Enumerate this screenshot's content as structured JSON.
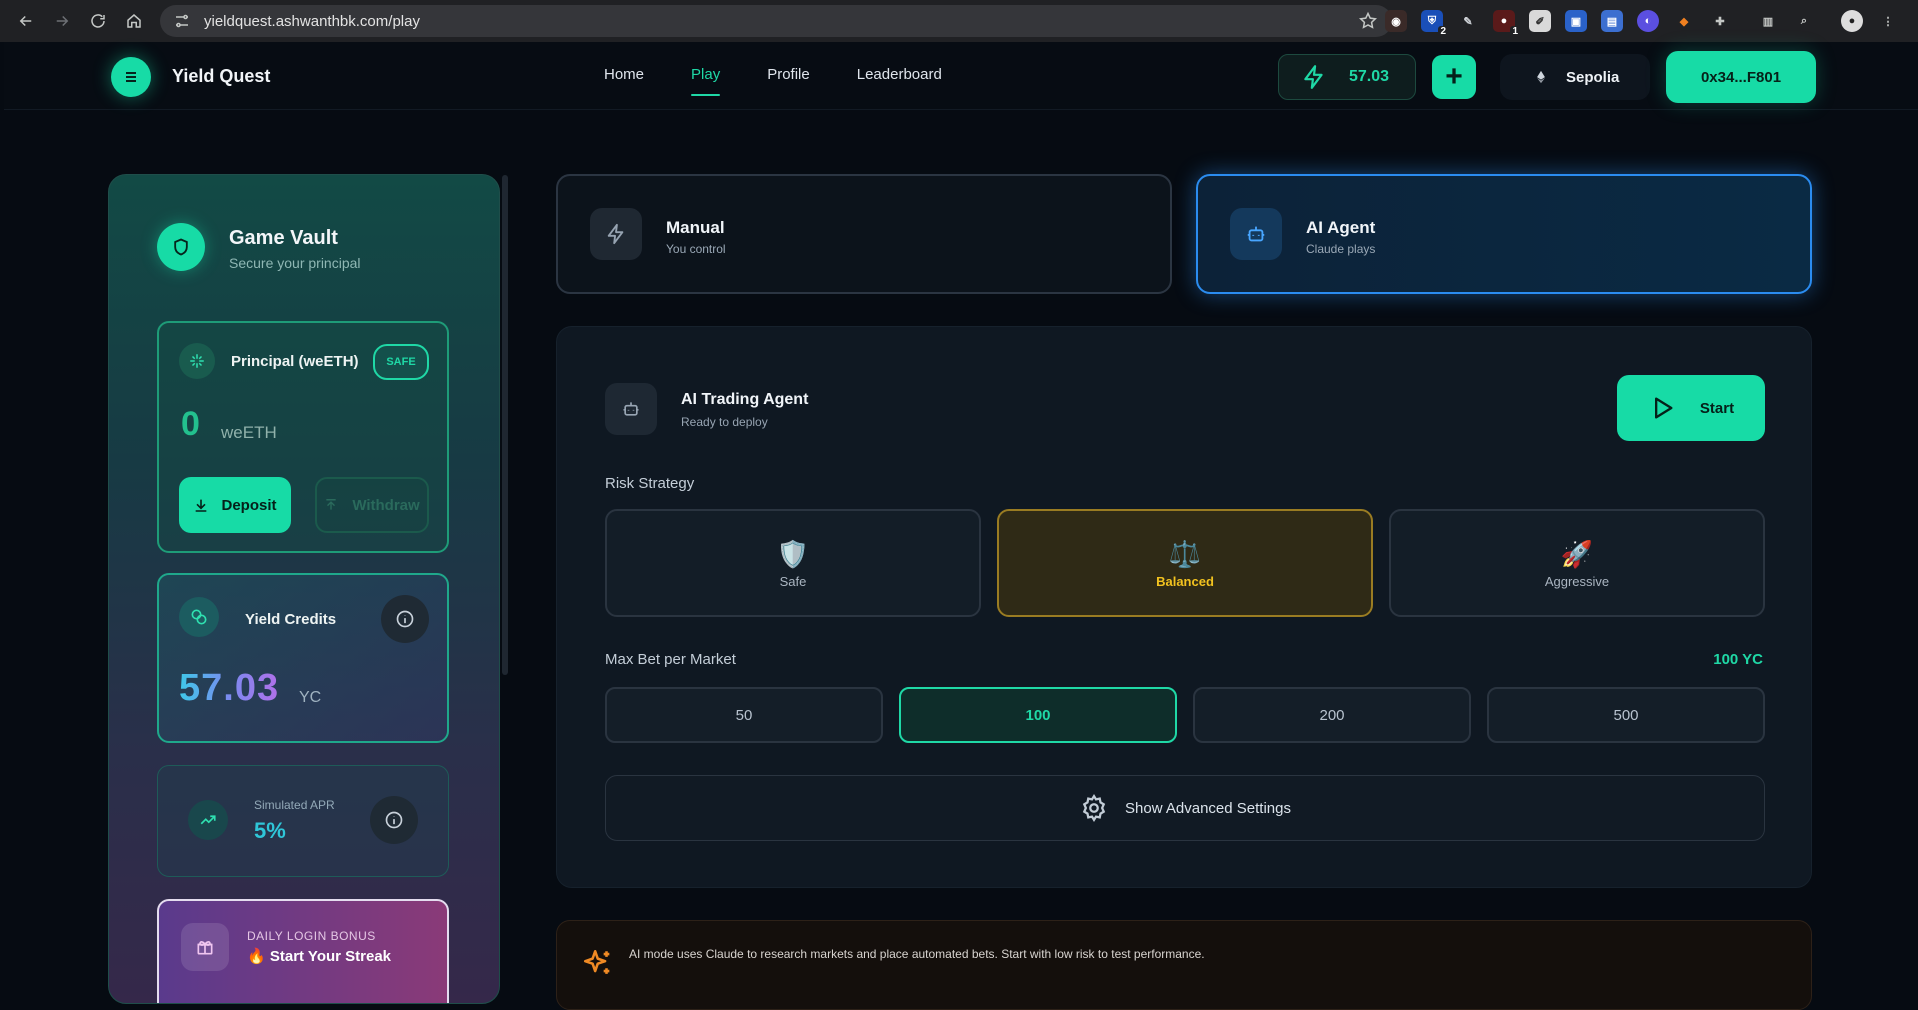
{
  "browser": {
    "url": "yieldquest.ashwanthbk.com/play",
    "extension_badges": [
      "2",
      "1"
    ]
  },
  "header": {
    "brand": "Yield Quest",
    "nav": [
      "Home",
      "Play",
      "Profile",
      "Leaderboard"
    ],
    "active_nav": "Play",
    "credits": "57.03",
    "network": "Sepolia",
    "wallet": "0x34...F801"
  },
  "vault": {
    "title": "Game Vault",
    "subtitle": "Secure your principal",
    "principal": {
      "title": "Principal (weETH)",
      "badge": "SAFE",
      "value": "0",
      "unit": "weETH",
      "deposit_label": "Deposit",
      "withdraw_label": "Withdraw"
    },
    "yield_credits": {
      "title": "Yield Credits",
      "value": "57.03",
      "unit": "YC"
    },
    "apr": {
      "label": "Simulated APR",
      "value": "5%"
    },
    "bonus": {
      "label": "DAILY LOGIN BONUS",
      "title": "Start Your Streak",
      "flame": "🔥"
    }
  },
  "modes": {
    "manual": {
      "title": "Manual",
      "subtitle": "You control"
    },
    "ai": {
      "title": "AI Agent",
      "subtitle": "Claude plays"
    },
    "selected": "ai"
  },
  "agent": {
    "title": "AI Trading Agent",
    "subtitle": "Ready to deploy",
    "start_label": "Start",
    "risk_label": "Risk Strategy",
    "risk_options": [
      {
        "emoji": "🛡️",
        "name": "Safe"
      },
      {
        "emoji": "⚖️",
        "name": "Balanced"
      },
      {
        "emoji": "🚀",
        "name": "Aggressive"
      }
    ],
    "risk_selected": "Balanced",
    "max_bet_label": "Max Bet per Market",
    "max_bet_value": "100 YC",
    "bet_options": [
      "50",
      "100",
      "200",
      "500"
    ],
    "bet_selected": "100",
    "advanced_label": "Show Advanced Settings"
  },
  "notice": {
    "text": "AI mode uses Claude to research markets and place automated bets. Start with low risk to test performance."
  },
  "colors": {
    "accent": "#17dba6",
    "ai_blue": "#2b8cf0",
    "balanced_gold": "#f2c21f",
    "background": "#060b12"
  }
}
